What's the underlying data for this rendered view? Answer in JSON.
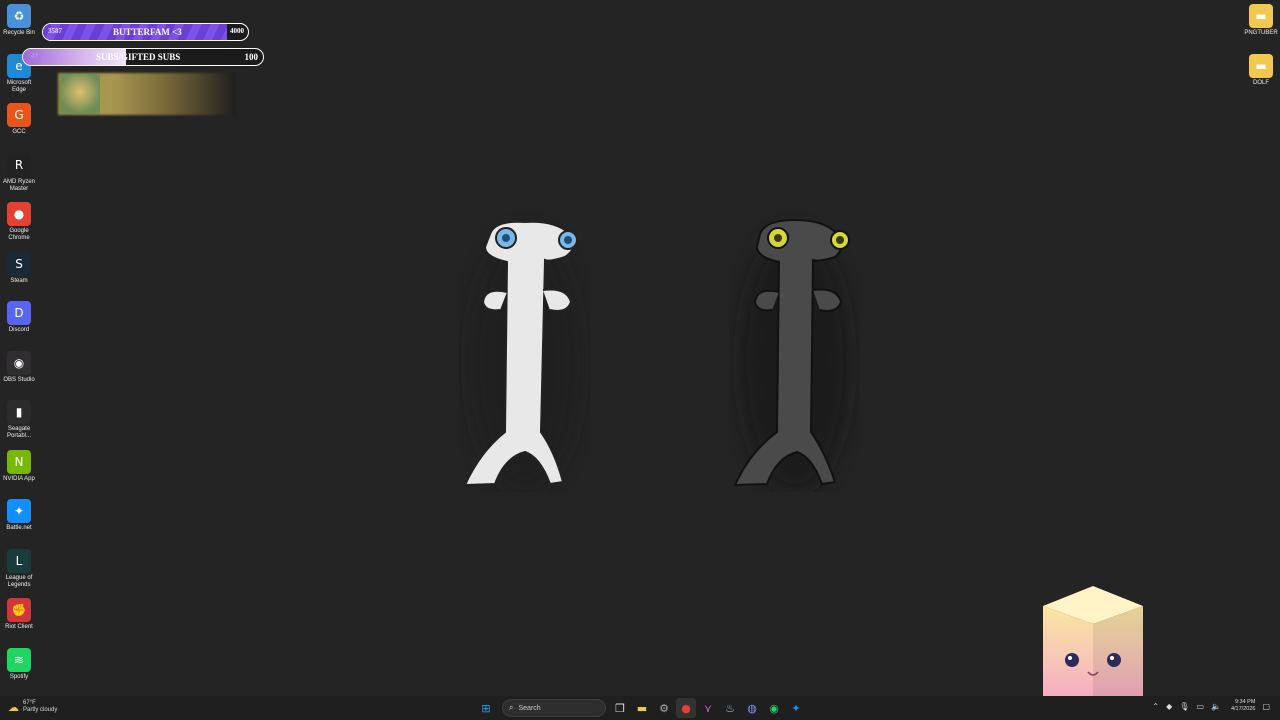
{
  "desktop_left": [
    {
      "label": "Recycle Bin",
      "icon": "recycle-bin-icon",
      "color": "#4a90d9",
      "glyph": "♻"
    },
    {
      "label": "Microsoft Edge",
      "icon": "edge-icon",
      "color": "#1e8ad6",
      "glyph": "e"
    },
    {
      "label": "GCC",
      "icon": "gcc-icon",
      "color": "#e8541c",
      "glyph": "G"
    },
    {
      "label": "AMD Ryzen Master",
      "icon": "ryzen-icon",
      "color": "#222222",
      "glyph": "R"
    },
    {
      "label": "Google Chrome",
      "icon": "chrome-icon",
      "color": "#e34133",
      "glyph": "●"
    },
    {
      "label": "Steam",
      "icon": "steam-icon",
      "color": "#1b2838",
      "glyph": "S"
    },
    {
      "label": "Discord",
      "icon": "discord-icon",
      "color": "#5865f2",
      "glyph": "D"
    },
    {
      "label": "OBS Studio",
      "icon": "obs-icon",
      "color": "#302e31",
      "glyph": "◉"
    },
    {
      "label": "Seagate Portabl...",
      "icon": "seagate-icon",
      "color": "#2b2b2b",
      "glyph": "▮"
    },
    {
      "label": "NVIDIA App",
      "icon": "nvidia-icon",
      "color": "#76b900",
      "glyph": "N"
    },
    {
      "label": "Battle.net",
      "icon": "battlenet-icon",
      "color": "#148eff",
      "glyph": "✦"
    },
    {
      "label": "League of Legends",
      "icon": "league-icon",
      "color": "#1a3b3b",
      "glyph": "L"
    },
    {
      "label": "Riot Client",
      "icon": "riot-icon",
      "color": "#d13639",
      "glyph": "✊"
    },
    {
      "label": "Spotify",
      "icon": "spotify-icon",
      "color": "#1ed760",
      "glyph": "≋"
    }
  ],
  "desktop_right": [
    {
      "label": "PNGTUBER",
      "icon": "folder-icon",
      "color": "#f2c94c",
      "glyph": "▬"
    },
    {
      "label": "DOLF",
      "icon": "folder-icon",
      "color": "#f2c94c",
      "glyph": "▬"
    }
  ],
  "overlay": {
    "followers_current": "3587",
    "followers_title": "BUTTERFAM <3",
    "followers_goal": "4000",
    "followers_progress": 0.897,
    "subs_current": "43",
    "subs_title": "SUBS/GIFTED SUBS",
    "subs_goal": "100",
    "subs_progress": 0.43
  },
  "taskbar": {
    "weather_temp": "67°F",
    "weather_desc": "Partly cloudy",
    "search_placeholder": "Search",
    "time": "9:34 PM",
    "date": "4/17/2026",
    "accent": "#0078d4"
  }
}
